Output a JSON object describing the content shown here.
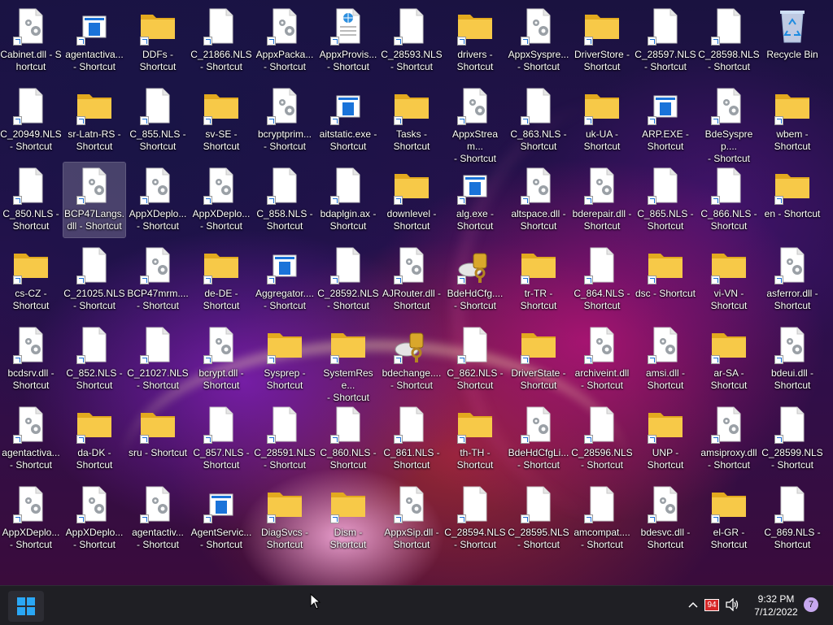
{
  "desktop": {
    "icons": [
      {
        "label": "Cabinet.dll - Shortcut",
        "type": "dll",
        "row": 0,
        "col": 0
      },
      {
        "label": "agentactiva...\n- Shortcut",
        "type": "exe",
        "row": 0,
        "col": 1
      },
      {
        "label": "DDFs -\nShortcut",
        "type": "folder",
        "row": 0,
        "col": 2
      },
      {
        "label": "C_21866.NLS\n- Shortcut",
        "type": "file",
        "row": 0,
        "col": 3
      },
      {
        "label": "AppxPacka...\n- Shortcut",
        "type": "dll",
        "row": 0,
        "col": 4
      },
      {
        "label": "AppxProvis...\n- Shortcut",
        "type": "web",
        "row": 0,
        "col": 5
      },
      {
        "label": "C_28593.NLS\n- Shortcut",
        "type": "file",
        "row": 0,
        "col": 6
      },
      {
        "label": "drivers -\nShortcut",
        "type": "folder",
        "row": 0,
        "col": 7
      },
      {
        "label": "AppxSyspre...\n- Shortcut",
        "type": "dll",
        "row": 0,
        "col": 8
      },
      {
        "label": "DriverStore -\nShortcut",
        "type": "folder",
        "row": 0,
        "col": 9
      },
      {
        "label": "C_28597.NLS\n- Shortcut",
        "type": "file",
        "row": 0,
        "col": 10
      },
      {
        "label": "C_28598.NLS\n- Shortcut",
        "type": "file",
        "row": 0,
        "col": 11
      },
      {
        "label": "Recycle Bin",
        "type": "recycle",
        "row": 0,
        "col": 12
      },
      {
        "label": "C_20949.NLS\n- Shortcut",
        "type": "file",
        "row": 1,
        "col": 0
      },
      {
        "label": "sr-Latn-RS -\nShortcut",
        "type": "folder",
        "row": 1,
        "col": 1
      },
      {
        "label": "C_855.NLS -\nShortcut",
        "type": "file",
        "row": 1,
        "col": 2
      },
      {
        "label": "sv-SE -\nShortcut",
        "type": "folder",
        "row": 1,
        "col": 3
      },
      {
        "label": "bcryptprim...\n- Shortcut",
        "type": "dll",
        "row": 1,
        "col": 4
      },
      {
        "label": "aitstatic.exe -\nShortcut",
        "type": "exe",
        "row": 1,
        "col": 5
      },
      {
        "label": "Tasks -\nShortcut",
        "type": "folder",
        "row": 1,
        "col": 6
      },
      {
        "label": "AppxStream...\n- Shortcut",
        "type": "dll",
        "row": 1,
        "col": 7
      },
      {
        "label": "C_863.NLS -\nShortcut",
        "type": "file",
        "row": 1,
        "col": 8
      },
      {
        "label": "uk-UA -\nShortcut",
        "type": "folder",
        "row": 1,
        "col": 9
      },
      {
        "label": "ARP.EXE -\nShortcut",
        "type": "exe",
        "row": 1,
        "col": 10
      },
      {
        "label": "BdeSysprep....\n- Shortcut",
        "type": "dll",
        "row": 1,
        "col": 11
      },
      {
        "label": "wbem -\nShortcut",
        "type": "folder",
        "row": 1,
        "col": 12
      },
      {
        "label": "C_850.NLS -\nShortcut",
        "type": "file",
        "row": 2,
        "col": 0
      },
      {
        "label": "BCP47Langs.\ndll - Shortcut",
        "type": "dll",
        "row": 2,
        "col": 1,
        "selected": true
      },
      {
        "label": "AppXDeplo...\n- Shortcut",
        "type": "dll",
        "row": 2,
        "col": 2
      },
      {
        "label": "AppXDeplo...\n- Shortcut",
        "type": "dll",
        "row": 2,
        "col": 3
      },
      {
        "label": "C_858.NLS -\nShortcut",
        "type": "file",
        "row": 2,
        "col": 4
      },
      {
        "label": "bdaplgin.ax -\nShortcut",
        "type": "file",
        "row": 2,
        "col": 5
      },
      {
        "label": "downlevel -\nShortcut",
        "type": "folder",
        "row": 2,
        "col": 6
      },
      {
        "label": "alg.exe -\nShortcut",
        "type": "exe",
        "row": 2,
        "col": 7
      },
      {
        "label": "altspace.dll -\nShortcut",
        "type": "dll",
        "row": 2,
        "col": 8
      },
      {
        "label": "bderepair.dll -\nShortcut",
        "type": "dll",
        "row": 2,
        "col": 9
      },
      {
        "label": "C_865.NLS -\nShortcut",
        "type": "file",
        "row": 2,
        "col": 10
      },
      {
        "label": "C_866.NLS -\nShortcut",
        "type": "file",
        "row": 2,
        "col": 11
      },
      {
        "label": "en - Shortcut",
        "type": "folder",
        "row": 2,
        "col": 12
      },
      {
        "label": "cs-CZ -\nShortcut",
        "type": "folder",
        "row": 3,
        "col": 0
      },
      {
        "label": "C_21025.NLS\n- Shortcut",
        "type": "file",
        "row": 3,
        "col": 1
      },
      {
        "label": "BCP47mrm....\n- Shortcut",
        "type": "dll",
        "row": 3,
        "col": 2
      },
      {
        "label": "de-DE -\nShortcut",
        "type": "folder",
        "row": 3,
        "col": 3
      },
      {
        "label": "Aggregator....\n- Shortcut",
        "type": "exe",
        "row": 3,
        "col": 4
      },
      {
        "label": "C_28592.NLS\n- Shortcut",
        "type": "file",
        "row": 3,
        "col": 5
      },
      {
        "label": "AJRouter.dll -\nShortcut",
        "type": "dll",
        "row": 3,
        "col": 6
      },
      {
        "label": "BdeHdCfg....\n- Shortcut",
        "type": "key",
        "row": 3,
        "col": 7
      },
      {
        "label": "tr-TR -\nShortcut",
        "type": "folder",
        "row": 3,
        "col": 8
      },
      {
        "label": "C_864.NLS -\nShortcut",
        "type": "file",
        "row": 3,
        "col": 9
      },
      {
        "label": "dsc - Shortcut",
        "type": "folder",
        "row": 3,
        "col": 10
      },
      {
        "label": "vi-VN -\nShortcut",
        "type": "folder",
        "row": 3,
        "col": 11
      },
      {
        "label": "asferror.dll -\nShortcut",
        "type": "dll",
        "row": 3,
        "col": 12
      },
      {
        "label": "bcdsrv.dll -\nShortcut",
        "type": "dll",
        "row": 4,
        "col": 0
      },
      {
        "label": "C_852.NLS -\nShortcut",
        "type": "file",
        "row": 4,
        "col": 1
      },
      {
        "label": "C_21027.NLS\n- Shortcut",
        "type": "file",
        "row": 4,
        "col": 2
      },
      {
        "label": "bcrypt.dll -\nShortcut",
        "type": "dll",
        "row": 4,
        "col": 3
      },
      {
        "label": "Sysprep -\nShortcut",
        "type": "folder",
        "row": 4,
        "col": 4
      },
      {
        "label": "SystemRese...\n- Shortcut",
        "type": "folder",
        "row": 4,
        "col": 5
      },
      {
        "label": "bdechange....\n- Shortcut",
        "type": "key",
        "row": 4,
        "col": 6
      },
      {
        "label": "C_862.NLS -\nShortcut",
        "type": "file",
        "row": 4,
        "col": 7
      },
      {
        "label": "DriverState -\nShortcut",
        "type": "folder",
        "row": 4,
        "col": 8
      },
      {
        "label": "archiveint.dll\n- Shortcut",
        "type": "dll",
        "row": 4,
        "col": 9
      },
      {
        "label": "amsi.dll -\nShortcut",
        "type": "dll",
        "row": 4,
        "col": 10
      },
      {
        "label": "ar-SA -\nShortcut",
        "type": "folder",
        "row": 4,
        "col": 11
      },
      {
        "label": "bdeui.dll -\nShortcut",
        "type": "dll",
        "row": 4,
        "col": 12
      },
      {
        "label": "agentactiva...\n- Shortcut",
        "type": "dll",
        "row": 5,
        "col": 0
      },
      {
        "label": "da-DK -\nShortcut",
        "type": "folder",
        "row": 5,
        "col": 1
      },
      {
        "label": "sru - Shortcut",
        "type": "folder",
        "row": 5,
        "col": 2
      },
      {
        "label": "C_857.NLS -\nShortcut",
        "type": "file",
        "row": 5,
        "col": 3
      },
      {
        "label": "C_28591.NLS\n- Shortcut",
        "type": "file",
        "row": 5,
        "col": 4
      },
      {
        "label": "C_860.NLS -\nShortcut",
        "type": "file",
        "row": 5,
        "col": 5
      },
      {
        "label": "C_861.NLS -\nShortcut",
        "type": "file",
        "row": 5,
        "col": 6
      },
      {
        "label": "th-TH -\nShortcut",
        "type": "folder",
        "row": 5,
        "col": 7
      },
      {
        "label": "BdeHdCfgLi...\n- Shortcut",
        "type": "dll",
        "row": 5,
        "col": 8
      },
      {
        "label": "C_28596.NLS\n- Shortcut",
        "type": "file",
        "row": 5,
        "col": 9
      },
      {
        "label": "UNP -\nShortcut",
        "type": "folder",
        "row": 5,
        "col": 10
      },
      {
        "label": "amsiproxy.dll\n- Shortcut",
        "type": "dll",
        "row": 5,
        "col": 11
      },
      {
        "label": "C_28599.NLS\n- Shortcut",
        "type": "file",
        "row": 5,
        "col": 12
      },
      {
        "label": "AppXDeplo...\n- Shortcut",
        "type": "dll",
        "row": 6,
        "col": 0
      },
      {
        "label": "AppXDeplo...\n- Shortcut",
        "type": "dll",
        "row": 6,
        "col": 1
      },
      {
        "label": "agentactiv...\n- Shortcut",
        "type": "dll",
        "row": 6,
        "col": 2
      },
      {
        "label": "AgentServic...\n- Shortcut",
        "type": "exe",
        "row": 6,
        "col": 3
      },
      {
        "label": "DiagSvcs -\nShortcut",
        "type": "folder",
        "row": 6,
        "col": 4
      },
      {
        "label": "Dism -\nShortcut",
        "type": "folder",
        "row": 6,
        "col": 5
      },
      {
        "label": "AppxSip.dll -\nShortcut",
        "type": "dll",
        "row": 6,
        "col": 6
      },
      {
        "label": "C_28594.NLS\n- Shortcut",
        "type": "file",
        "row": 6,
        "col": 7
      },
      {
        "label": "C_28595.NLS\n- Shortcut",
        "type": "file",
        "row": 6,
        "col": 8
      },
      {
        "label": "amcompat....\n- Shortcut",
        "type": "file",
        "row": 6,
        "col": 9
      },
      {
        "label": "bdesvc.dll -\nShortcut",
        "type": "dll",
        "row": 6,
        "col": 10
      },
      {
        "label": "el-GR -\nShortcut",
        "type": "folder",
        "row": 6,
        "col": 11
      },
      {
        "label": "C_869.NLS -\nShortcut",
        "type": "file",
        "row": 6,
        "col": 12
      }
    ]
  },
  "taskbar": {
    "start_icon": "windows-logo-icon",
    "tray": {
      "chevron_icon": "chevron-up-icon",
      "battery_value": "94",
      "volume_icon": "speaker-icon"
    },
    "clock": {
      "time": "9:32 PM",
      "date": "7/12/2022"
    },
    "notification_count": "7"
  },
  "colors": {
    "folder": "#f7c948",
    "folder_dark": "#e3a91f",
    "exe_blue": "#1a73d9",
    "taskbar": "#1f1f24",
    "badge": "#c7a8ef",
    "battery_red": "#d62828"
  }
}
